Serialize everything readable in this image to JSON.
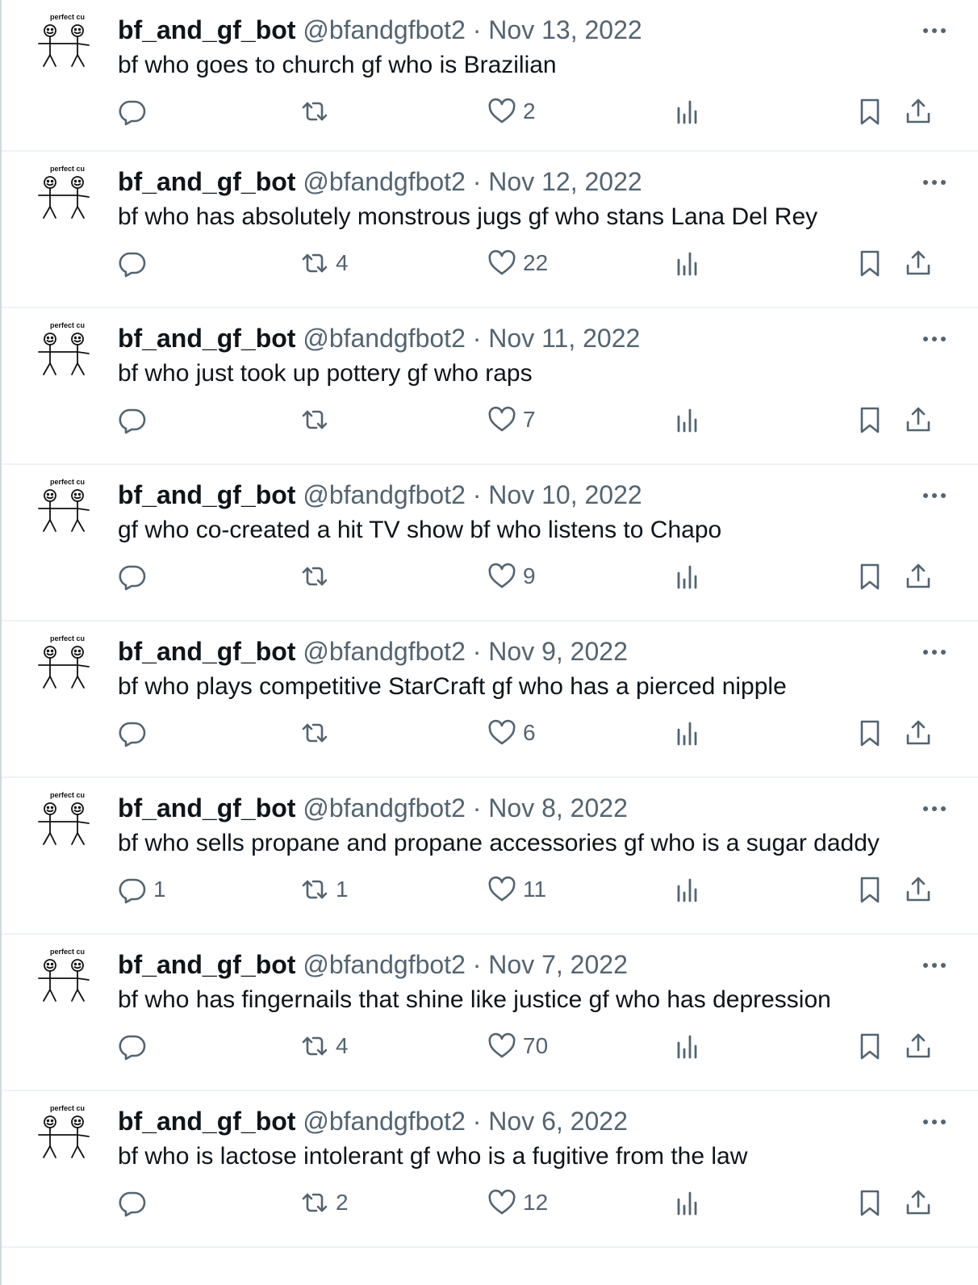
{
  "icons": {
    "reply": "reply-icon",
    "retweet": "retweet-icon",
    "like": "heart-icon",
    "views": "views-icon",
    "bookmark": "bookmark-icon",
    "share": "share-icon",
    "more": "more-icon",
    "avatar": "stick-figure-couple-avatar"
  },
  "avatar_text": "perfect cu",
  "colors": {
    "muted": "#536471",
    "text": "#0f1419",
    "divider": "#eff3f4"
  },
  "tweets": [
    {
      "author": "bf_and_gf_bot",
      "handle": "@bfandgfbot2",
      "sep": "·",
      "date": "Nov 13, 2022",
      "text": "bf who goes to church gf who is Brazilian",
      "replies": "",
      "retweets": "",
      "likes": "2"
    },
    {
      "author": "bf_and_gf_bot",
      "handle": "@bfandgfbot2",
      "sep": "·",
      "date": "Nov 12, 2022",
      "text": "bf who has absolutely monstrous jugs gf who stans Lana Del Rey",
      "replies": "",
      "retweets": "4",
      "likes": "22"
    },
    {
      "author": "bf_and_gf_bot",
      "handle": "@bfandgfbot2",
      "sep": "·",
      "date": "Nov 11, 2022",
      "text": "bf who just took up pottery gf who raps",
      "replies": "",
      "retweets": "",
      "likes": "7"
    },
    {
      "author": "bf_and_gf_bot",
      "handle": "@bfandgfbot2",
      "sep": "·",
      "date": "Nov 10, 2022",
      "text": "gf who co-created a hit TV show bf who listens to Chapo",
      "replies": "",
      "retweets": "",
      "likes": "9"
    },
    {
      "author": "bf_and_gf_bot",
      "handle": "@bfandgfbot2",
      "sep": "·",
      "date": "Nov 9, 2022",
      "text": "bf who plays competitive StarCraft gf who has a pierced nipple",
      "replies": "",
      "retweets": "",
      "likes": "6"
    },
    {
      "author": "bf_and_gf_bot",
      "handle": "@bfandgfbot2",
      "sep": "·",
      "date": "Nov 8, 2022",
      "text": "bf who sells propane and propane accessories gf who is a sugar daddy",
      "replies": "1",
      "retweets": "1",
      "likes": "11"
    },
    {
      "author": "bf_and_gf_bot",
      "handle": "@bfandgfbot2",
      "sep": "·",
      "date": "Nov 7, 2022",
      "text": "bf who has fingernails that shine like justice gf who has depression",
      "replies": "",
      "retweets": "4",
      "likes": "70"
    },
    {
      "author": "bf_and_gf_bot",
      "handle": "@bfandgfbot2",
      "sep": "·",
      "date": "Nov 6, 2022",
      "text": "bf who is lactose intolerant gf who is a fugitive from the law",
      "replies": "",
      "retweets": "2",
      "likes": "12"
    }
  ]
}
